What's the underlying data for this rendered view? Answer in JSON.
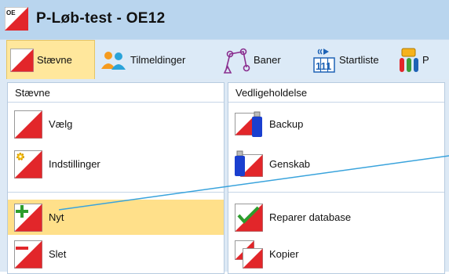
{
  "window": {
    "logo_text": "OE",
    "title": "P-Løb-test  -  OE12"
  },
  "toolbar": {
    "items": [
      {
        "label": "Stævne",
        "icon": "orienteering-flag-icon",
        "active": true
      },
      {
        "label": "Tilmeldinger",
        "icon": "people-icon"
      },
      {
        "label": "Baner",
        "icon": "course-route-icon"
      },
      {
        "label": "Startliste",
        "icon": "start-clock-icon"
      },
      {
        "label": "P",
        "icon": "si-cards-icon"
      }
    ]
  },
  "panels": {
    "left": {
      "title": "Stævne",
      "items": [
        {
          "label": "Vælg",
          "icon": "flag-icon"
        },
        {
          "label": "Indstillinger",
          "icon": "flag-settings-icon"
        },
        {
          "label": "Nyt",
          "icon": "flag-new-icon",
          "selected": true
        },
        {
          "label": "Slet",
          "icon": "flag-delete-icon"
        }
      ]
    },
    "right": {
      "title": "Vedligeholdelse",
      "items": [
        {
          "label": "Backup",
          "icon": "flag-usb-backup-icon"
        },
        {
          "label": "Genskab",
          "icon": "usb-flag-restore-icon"
        },
        {
          "label": "Reparer database",
          "icon": "checkmark-flag-icon"
        },
        {
          "label": "Kopier",
          "icon": "flag-copy-icon"
        }
      ]
    }
  },
  "colors": {
    "accent_red": "#e2262a",
    "title_bar": "#b9d5ee",
    "toolbar_bg": "#dceaf7",
    "selection": "#ffe08a",
    "annotation_line": "#39a3dc"
  }
}
